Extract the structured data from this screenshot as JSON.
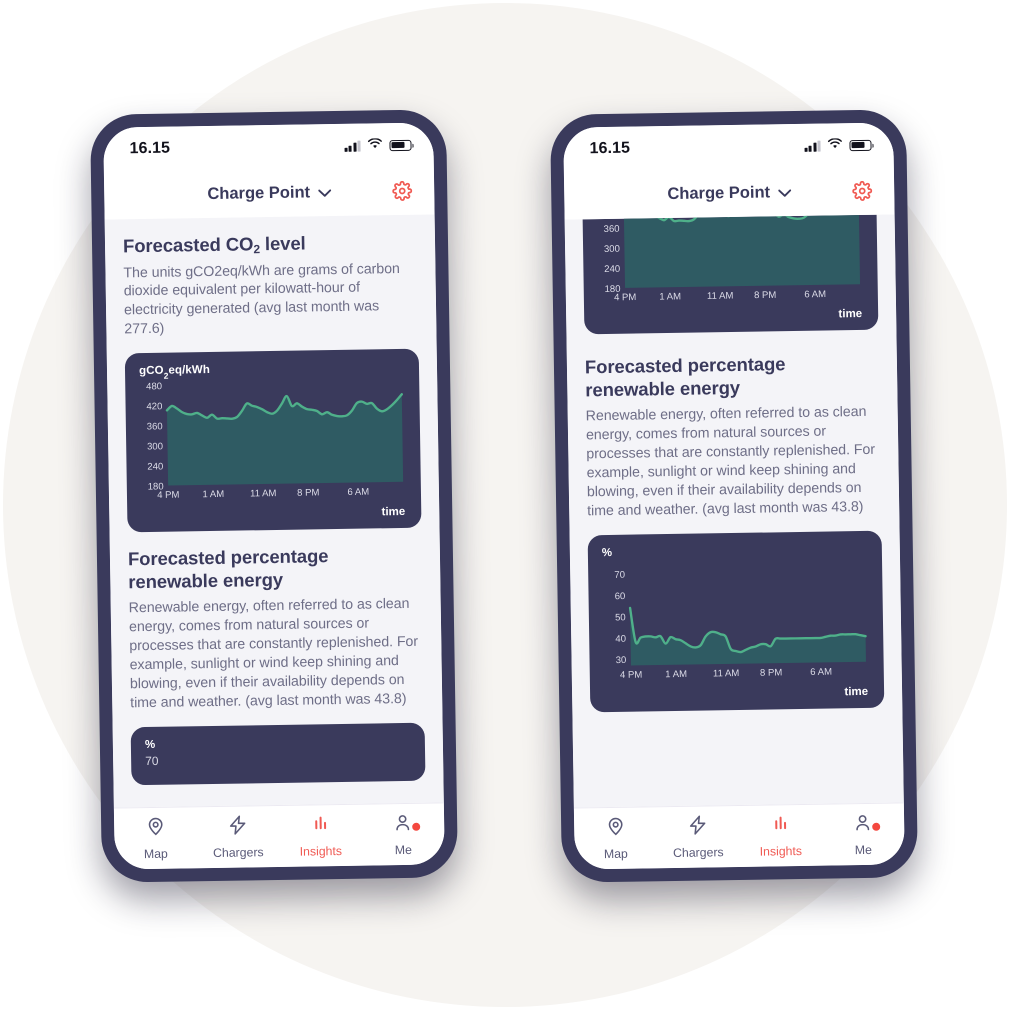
{
  "canvas": {
    "background": "#ffffff",
    "circle_color": "#f6f4f1"
  },
  "theme": {
    "frame": "#3a3a5c",
    "card_bg": "#3a3a5c",
    "page_bg": "#f4f4f8",
    "accent_red": "#f05a53",
    "line_green": "#4fb08a",
    "area_teal": "#2f5b63",
    "title_color": "#3a3a5c",
    "body_color": "#6e6e87"
  },
  "status_bar": {
    "time": "16.15",
    "signal_icon": "signal-bars-icon",
    "wifi_icon": "wifi-icon",
    "battery_icon": "battery-icon"
  },
  "header": {
    "title": "Charge Point",
    "chevron_icon": "chevron-down-icon",
    "settings_icon": "gear-icon"
  },
  "sections": {
    "co2": {
      "title_main": "Forecasted CO",
      "title_sub": "2",
      "title_tail": " level",
      "body": "The units gCO2eq/kWh are grams of carbon dioxide equivalent per kilowatt-hour of electricity generated (avg last month was 277.6)"
    },
    "renewable": {
      "title": "Forecasted percentage renewable energy",
      "body": "Renewable energy, often referred to as clean energy, comes from natural sources or processes that are constantly replenished. For example, sunlight or wind keep shining and blowing, even if their availability depends on time and weather. (avg last month was 43.8)"
    }
  },
  "chart_labels": {
    "time_label": "time",
    "co2_unit_main": "gCO",
    "co2_unit_sub": "2",
    "co2_unit_tail": "eq/kWh",
    "pct_unit": "%"
  },
  "tabbar": {
    "items": [
      {
        "label": "Map",
        "icon": "map-pin-icon",
        "active": false,
        "badge": false
      },
      {
        "label": "Chargers",
        "icon": "lightning-bolt-icon",
        "active": false,
        "badge": false
      },
      {
        "label": "Insights",
        "icon": "bar-chart-icon",
        "active": true,
        "badge": false
      },
      {
        "label": "Me",
        "icon": "person-icon",
        "active": false,
        "badge": true
      }
    ]
  },
  "chart_data": [
    {
      "id": "co2-chart",
      "type": "area",
      "title": "Forecasted CO2 level",
      "ylabel": "gCO2eq/kWh",
      "xlabel": "time",
      "ylim": [
        180,
        480
      ],
      "yticks": [
        180,
        240,
        300,
        360,
        420,
        480
      ],
      "xticks": [
        "4 PM",
        "1 AM",
        "11 AM",
        "8 PM",
        "6 AM"
      ],
      "xtick_positions": [
        0,
        9,
        19,
        28,
        38
      ],
      "grid": false,
      "legend": "none",
      "line_color": "#4fb08a",
      "fill_color": "#2f5b63",
      "x": [
        0,
        1,
        2,
        3,
        4,
        5,
        6,
        7,
        8,
        9,
        10,
        11,
        12,
        13,
        14,
        15,
        16,
        17,
        18,
        19,
        20,
        21,
        22,
        23,
        24,
        25,
        26,
        27,
        28,
        29,
        30,
        31,
        32,
        33,
        34,
        35,
        36,
        37,
        38,
        39,
        40,
        41,
        42,
        43,
        44,
        45,
        46,
        47
      ],
      "values": [
        405,
        418,
        410,
        399,
        393,
        392,
        396,
        388,
        381,
        390,
        378,
        379,
        378,
        377,
        382,
        400,
        422,
        415,
        411,
        404,
        395,
        390,
        399,
        420,
        442,
        412,
        420,
        410,
        402,
        400,
        396,
        386,
        392,
        384,
        380,
        379,
        382,
        396,
        418,
        422,
        415,
        417,
        400,
        392,
        398,
        410,
        425,
        442
      ]
    },
    {
      "id": "renewable-chart",
      "type": "area",
      "title": "Forecasted percentage renewable energy",
      "ylabel": "%",
      "xlabel": "time",
      "ylim": [
        27,
        74
      ],
      "yticks": [
        30,
        40,
        50,
        60,
        70
      ],
      "xticks": [
        "4 PM",
        "1 AM",
        "11 AM",
        "8 PM",
        "6 AM"
      ],
      "xtick_positions": [
        0,
        9,
        19,
        28,
        38
      ],
      "grid": false,
      "legend": "none",
      "line_color": "#4fb08a",
      "fill_color": "#2f5b63",
      "x": [
        0,
        1,
        2,
        3,
        4,
        5,
        6,
        7,
        8,
        9,
        10,
        11,
        12,
        13,
        14,
        15,
        16,
        17,
        18,
        19,
        20,
        21,
        22,
        23,
        24,
        25,
        26,
        27,
        28,
        29,
        30,
        31,
        32,
        33,
        34,
        35,
        36,
        37,
        38,
        39,
        40,
        41,
        42,
        43,
        44,
        45,
        46,
        47
      ],
      "values": [
        54,
        38,
        40,
        40.5,
        40.5,
        40,
        40.5,
        37,
        40,
        39,
        38.5,
        37,
        35.5,
        35,
        36,
        40,
        42,
        42,
        41,
        40,
        34,
        33,
        32.5,
        33.5,
        34.5,
        35,
        36,
        36,
        35,
        38.5,
        38.5,
        38.5,
        38.5,
        38.5,
        38.5,
        38.5,
        38.5,
        38.5,
        38.5,
        39,
        39.5,
        39.5,
        40,
        40,
        40,
        40,
        39.5,
        39
      ]
    }
  ]
}
